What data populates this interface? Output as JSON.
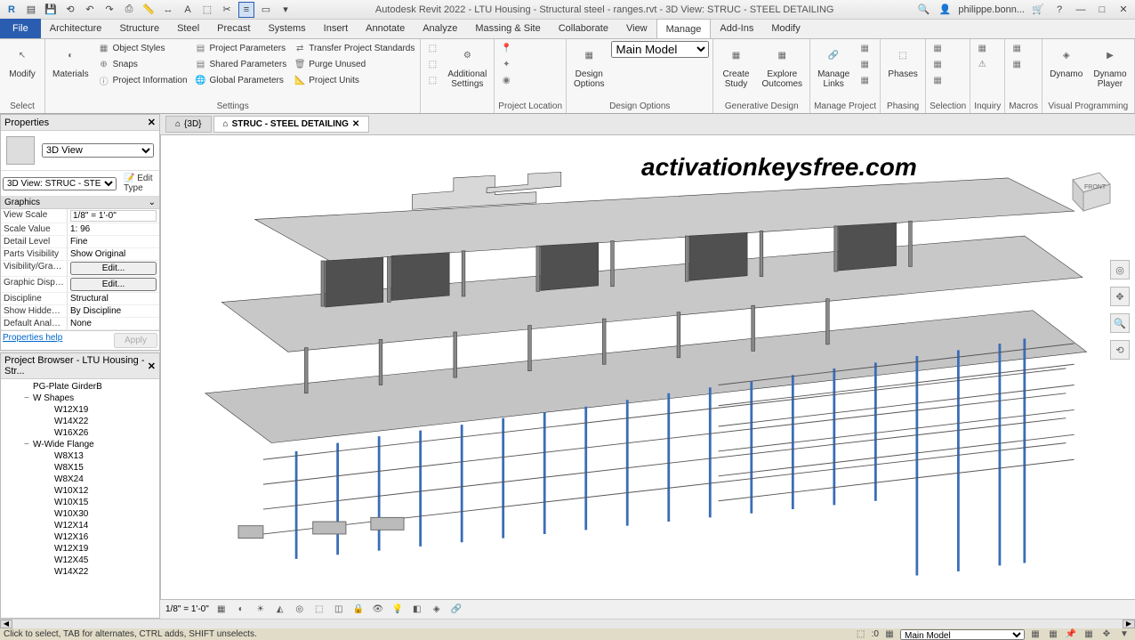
{
  "app": {
    "title": "Autodesk Revit 2022 - LTU Housing - Structural steel - ranges.rvt - 3D View: STRUC - STEEL DETAILING",
    "user": "philippe.bonn..."
  },
  "tabs": {
    "file": "File",
    "items": [
      "Architecture",
      "Structure",
      "Steel",
      "Precast",
      "Systems",
      "Insert",
      "Annotate",
      "Analyze",
      "Massing & Site",
      "Collaborate",
      "View",
      "Manage",
      "Add-Ins",
      "Modify"
    ],
    "active": "Manage"
  },
  "ribbon": {
    "modify": "Modify",
    "select": "Select",
    "materials": "Materials",
    "snaps": "Snaps",
    "obj_styles": "Object  Styles",
    "proj_info": "Project  Information",
    "proj_params": "Project  Parameters",
    "shared_params": "Shared  Parameters",
    "global_params": "Global  Parameters",
    "transfer": "Transfer  Project Standards",
    "purge": "Purge  Unused",
    "proj_units": "Project  Units",
    "settings_label": "Settings",
    "addl_settings": "Additional\nSettings",
    "proj_location_label": "Project Location",
    "design_options": "Design\nOptions",
    "main_model": "Main Model",
    "design_options_label": "Design Options",
    "create_study": "Create\nStudy",
    "explore_outcomes": "Explore\nOutcomes",
    "gen_design_label": "Generative Design",
    "manage_links": "Manage\nLinks",
    "manage_project_label": "Manage Project",
    "phases": "Phases",
    "phasing_label": "Phasing",
    "selection_label": "Selection",
    "inquiry_label": "Inquiry",
    "macros_label": "Macros",
    "dynamo": "Dynamo",
    "dynamo_player": "Dynamo\nPlayer",
    "visual_prog_label": "Visual Programming"
  },
  "properties": {
    "title": "Properties",
    "view_type": "3D View",
    "view_name": "3D View: STRUC - STE",
    "edit_type": "Edit Type",
    "group": "Graphics",
    "rows": {
      "view_scale_k": "View Scale",
      "view_scale_v": "1/8\" = 1'-0\"",
      "scale_value_k": "Scale Value",
      "scale_value_v": "1:  96",
      "detail_k": "Detail Level",
      "detail_v": "Fine",
      "parts_k": "Parts Visibility",
      "parts_v": "Show Original",
      "vis_k": "Visibility/Grap...",
      "vis_v": "Edit...",
      "disp_k": "Graphic Displ...",
      "disp_v": "Edit...",
      "disc_k": "Discipline",
      "disc_v": "Structural",
      "hidden_k": "Show Hidden ...",
      "hidden_v": "By Discipline",
      "analy_k": "Default Analys...",
      "analy_v": "None"
    },
    "help": "Properties help",
    "apply": "Apply"
  },
  "browser": {
    "title": "Project Browser - LTU Housing - Str...",
    "items": [
      {
        "label": "PG-Plate GirderB",
        "level": 1,
        "exp": ""
      },
      {
        "label": "W Shapes",
        "level": 1,
        "exp": "−"
      },
      {
        "label": "W12X19",
        "level": 2,
        "exp": ""
      },
      {
        "label": "W14X22",
        "level": 2,
        "exp": ""
      },
      {
        "label": "W16X26",
        "level": 2,
        "exp": ""
      },
      {
        "label": "W-Wide Flange",
        "level": 1,
        "exp": "−"
      },
      {
        "label": "W8X13",
        "level": 2,
        "exp": ""
      },
      {
        "label": "W8X15",
        "level": 2,
        "exp": ""
      },
      {
        "label": "W8X24",
        "level": 2,
        "exp": ""
      },
      {
        "label": "W10X12",
        "level": 2,
        "exp": ""
      },
      {
        "label": "W10X15",
        "level": 2,
        "exp": ""
      },
      {
        "label": "W10X30",
        "level": 2,
        "exp": ""
      },
      {
        "label": "W12X14",
        "level": 2,
        "exp": ""
      },
      {
        "label": "W12X16",
        "level": 2,
        "exp": ""
      },
      {
        "label": "W12X19",
        "level": 2,
        "exp": ""
      },
      {
        "label": "W12X45",
        "level": 2,
        "exp": ""
      },
      {
        "label": "W14X22",
        "level": 2,
        "exp": ""
      }
    ]
  },
  "viewtabs": {
    "tab1": "{3D}",
    "tab2": "STRUC - STEEL DETAILING"
  },
  "watermark": "activationkeysfree.com",
  "viewbar": {
    "scale": "1/8\" = 1'-0\""
  },
  "status": {
    "hint": "Click to select, TAB for alternates, CTRL adds, SHIFT unselects.",
    "sel_count": ":0",
    "model": "Main Model"
  }
}
